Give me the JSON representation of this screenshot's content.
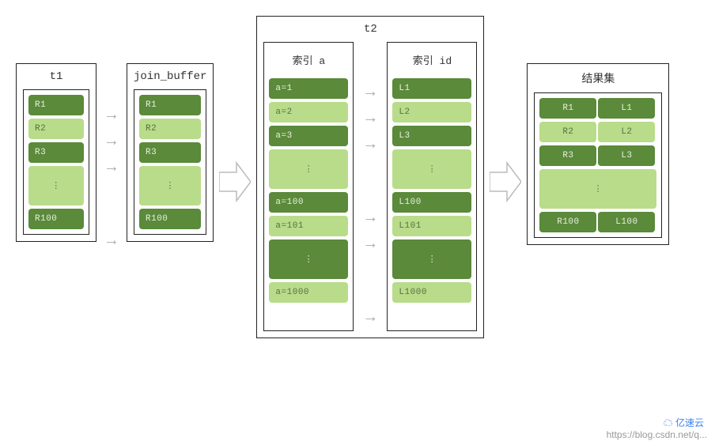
{
  "t1": {
    "title": "t1",
    "rows": [
      "R1",
      "R2",
      "R3",
      "⋮",
      "R100"
    ],
    "shades": [
      "dark",
      "light",
      "dark",
      "light",
      "dark"
    ]
  },
  "join_buffer": {
    "title": "join_buffer",
    "rows": [
      "R1",
      "R2",
      "R3",
      "⋮",
      "R100"
    ],
    "shades": [
      "dark",
      "light",
      "dark",
      "light",
      "dark"
    ]
  },
  "t2": {
    "title": "t2",
    "col_a": {
      "title": "索引 a",
      "rows": [
        "a=1",
        "a=2",
        "a=3",
        "⋮",
        "a=100",
        "a=101",
        "⋮",
        "a=1000"
      ],
      "shades": [
        "dark",
        "light",
        "dark",
        "light",
        "dark",
        "light",
        "dark",
        "light"
      ]
    },
    "col_id": {
      "title": "索引 id",
      "rows": [
        "L1",
        "L2",
        "L3",
        "⋮",
        "L100",
        "L101",
        "⋮",
        "L1000"
      ],
      "shades": [
        "dark",
        "light",
        "dark",
        "light",
        "dark",
        "light",
        "dark",
        "light"
      ]
    }
  },
  "results": {
    "title": "结果集",
    "rows": [
      {
        "left": "R1",
        "right": "L1",
        "shade": "dark"
      },
      {
        "left": "R2",
        "right": "L2",
        "shade": "light"
      },
      {
        "left": "R3",
        "right": "L3",
        "shade": "dark"
      },
      {
        "left": "",
        "right": "⋮",
        "shade": "light",
        "ellipsis": true
      },
      {
        "left": "R100",
        "right": "L100",
        "shade": "dark"
      }
    ]
  },
  "watermark": {
    "url": "https://blog.csdn.net/q...",
    "brand": "亿速云"
  },
  "colors": {
    "dark": "#5a8a3a",
    "light": "#b8dc8a",
    "arrow": "#cccccc",
    "border": "#222222"
  }
}
